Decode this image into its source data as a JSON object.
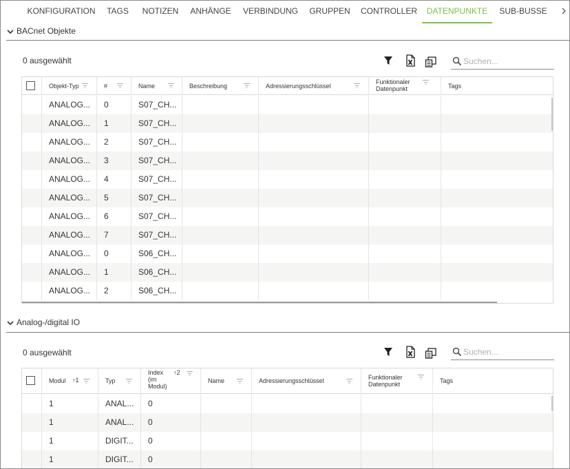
{
  "tabs": [
    "KONFIGURATION",
    "TAGS",
    "NOTIZEN",
    "ANHÄNGE",
    "VERBINDUNG",
    "GRUPPEN",
    "CONTROLLER",
    "DATENPUNKTE",
    "SUB-BUSSE"
  ],
  "active_tab": "DATENPUNKTE",
  "accent_color": "#7cc242",
  "bacnet": {
    "title": "BACnet Objekte",
    "selected": "0 ausgewählt",
    "search_placeholder": "Suchen...",
    "columns": [
      "Objekt-Typ",
      "#",
      "Name",
      "Beschreibung",
      "Adressierungsschlüssel",
      "Funktionaler Datenpunkt",
      "Tags"
    ],
    "rows": [
      {
        "type": "ANALOG...",
        "num": "0",
        "name": "S07_CH..."
      },
      {
        "type": "ANALOG...",
        "num": "1",
        "name": "S07_CH..."
      },
      {
        "type": "ANALOG...",
        "num": "2",
        "name": "S07_CH..."
      },
      {
        "type": "ANALOG...",
        "num": "3",
        "name": "S07_CH..."
      },
      {
        "type": "ANALOG...",
        "num": "4",
        "name": "S07_CH..."
      },
      {
        "type": "ANALOG...",
        "num": "5",
        "name": "S07_CH..."
      },
      {
        "type": "ANALOG...",
        "num": "6",
        "name": "S07_CH..."
      },
      {
        "type": "ANALOG...",
        "num": "7",
        "name": "S07_CH..."
      },
      {
        "type": "ANALOG...",
        "num": "0",
        "name": "S06_CH..."
      },
      {
        "type": "ANALOG...",
        "num": "1",
        "name": "S06_CH..."
      },
      {
        "type": "ANALOG...",
        "num": "2",
        "name": "S06_CH..."
      }
    ]
  },
  "io": {
    "title": "Analog-/digital IO",
    "selected": "0 ausgewählt",
    "search_placeholder": "Suchen...",
    "columns": [
      "Modul",
      "Typ",
      "Index (im Modul)",
      "Name",
      "Adressierungsschlüssel",
      "Funktionaler Datenpunkt",
      "Tags"
    ],
    "sort_modul": "1",
    "sort_index": "2",
    "rows": [
      {
        "modul": "1",
        "typ": "ANAL...",
        "index": "0"
      },
      {
        "modul": "1",
        "typ": "ANAL...",
        "index": "0"
      },
      {
        "modul": "1",
        "typ": "DIGIT...",
        "index": "0"
      },
      {
        "modul": "1",
        "typ": "DIGIT...",
        "index": "0"
      }
    ]
  }
}
